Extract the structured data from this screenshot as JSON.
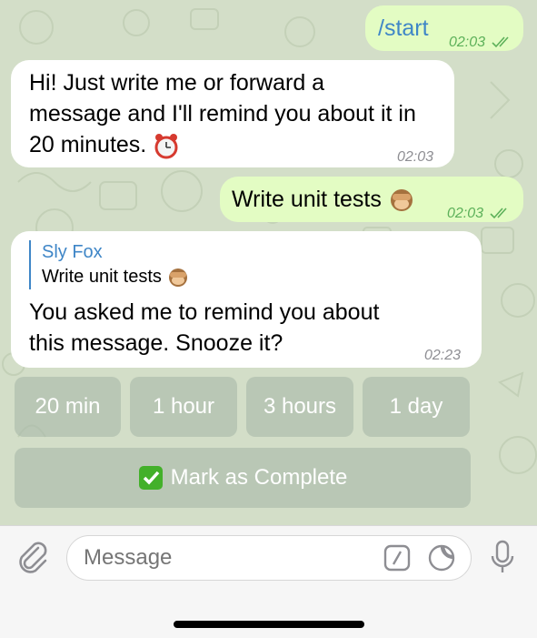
{
  "messages": {
    "start": {
      "text": "/start",
      "time": "02:03"
    },
    "greeting": {
      "line1": "Hi! Just write me or forward a",
      "line2": "message and I'll remind you about it in",
      "line3": "20 minutes.",
      "time": "02:03",
      "emoji": "alarm-clock"
    },
    "unit_tests": {
      "text": "Write unit tests",
      "time": "02:03",
      "emoji": "see-no-evil-monkey"
    },
    "reminder": {
      "reply_author": "Sly Fox",
      "reply_text": "Write unit tests",
      "line1": "You asked me to remind you about",
      "line2": "this message. Snooze it?",
      "time": "02:23"
    }
  },
  "keyboard": {
    "snooze": [
      "20 min",
      "1 hour",
      "3 hours",
      "1 day"
    ],
    "complete_label": "Mark as Complete"
  },
  "composer": {
    "placeholder": "Message",
    "icons": [
      "paperclip-icon",
      "command-icon",
      "sticker-icon",
      "microphone-icon"
    ]
  },
  "colors": {
    "outgoing_bubble": "#e3fcc3",
    "incoming_bubble": "#ffffff",
    "link_blue": "#3f86c7",
    "check_green": "#5db15a"
  }
}
